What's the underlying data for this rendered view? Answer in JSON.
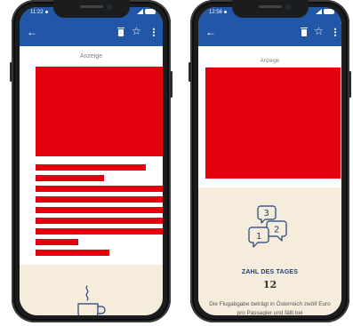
{
  "phones": [
    {
      "status_time": "11:22",
      "ad_label": "Anzeige",
      "icons": [
        "back-arrow-icon",
        "trash-icon",
        "star-icon",
        "more-vert-icon"
      ]
    },
    {
      "status_time": "12:56",
      "ad_label": "Anzeige",
      "icons": [
        "back-arrow-icon",
        "trash-icon",
        "star-icon",
        "more-vert-icon"
      ],
      "zahl_title": "ZAHL DES TAGES",
      "zahl_value": "12",
      "fact_text": "Die Flugabgabe beträgt in Österreich zwölf Euro pro Passagier und fällt bei"
    }
  ],
  "colors": {
    "appbar": "#2257a8",
    "ad_red": "#e3000f",
    "beige": "#f5ecdc",
    "title_blue": "#1f3f78"
  }
}
